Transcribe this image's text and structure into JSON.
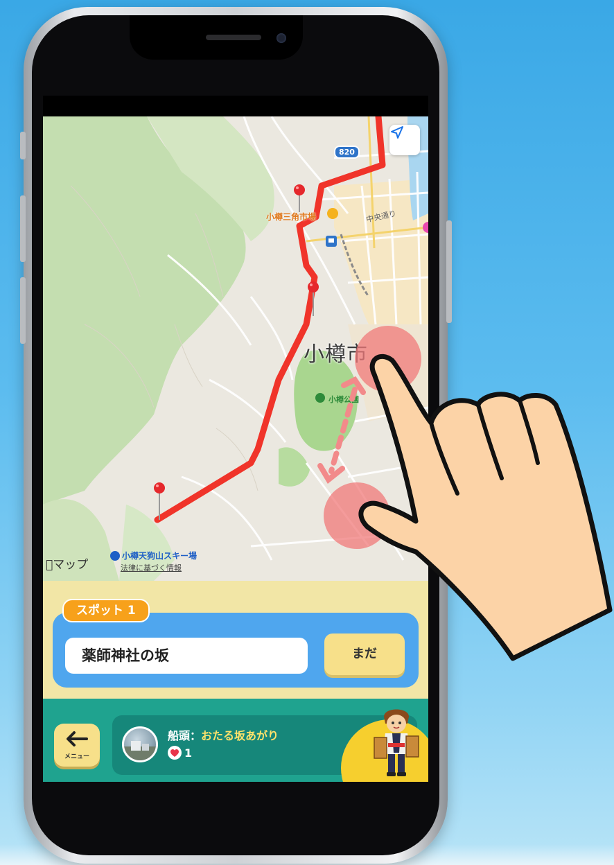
{
  "map": {
    "route_shield": "820",
    "city_label": "小樽市",
    "market_label": "小樽三角市場",
    "street_label": "中央通り",
    "park_label": "小樽公園",
    "ski_label": "小樽天狗山スキー場",
    "legal_label": "法律に基づく情報",
    "attribution": "マップ",
    "route_color": "#f0342a"
  },
  "spot": {
    "tag": "スポット 1",
    "name": "薬師神社の坂",
    "status_button": "まだ"
  },
  "bottom": {
    "menu_label": "メニュー",
    "captain_label": "船頭：",
    "captain_name": "おたる坂あがり",
    "likes": "1"
  },
  "icons": [
    "location-arrow-icon",
    "map-pin-icon",
    "back-arrow-icon",
    "heart-icon",
    "train-station-icon",
    "park-icon",
    "hand-gesture-icon"
  ]
}
